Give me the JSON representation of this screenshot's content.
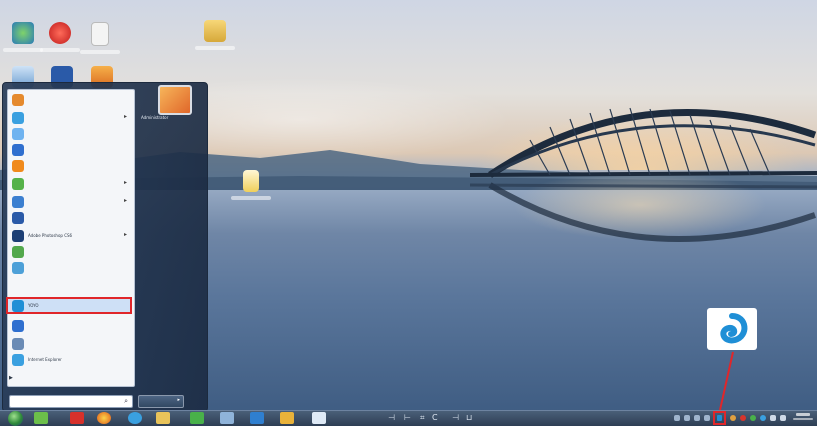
{
  "start_menu": {
    "programs": [
      {
        "label": "",
        "has_arrow": false,
        "icon": "package-icon",
        "color": "#e58a2e"
      },
      {
        "label": "",
        "has_arrow": true,
        "icon": "browser-icon",
        "color": "#3aa0e0"
      },
      {
        "label": "",
        "has_arrow": false,
        "icon": "document-icon",
        "color": "#6fb3f0"
      },
      {
        "label": "",
        "has_arrow": false,
        "icon": "bird-icon",
        "color": "#2f6fcf"
      },
      {
        "label": "",
        "has_arrow": false,
        "icon": "app-icon",
        "color": "#f08a1c"
      },
      {
        "label": "",
        "has_arrow": true,
        "icon": "sogou-icon",
        "color": "#55b24a"
      },
      {
        "label": "",
        "has_arrow": true,
        "icon": "window-icon",
        "color": "#3b7fd0"
      },
      {
        "label": "",
        "has_arrow": false,
        "icon": "k-icon",
        "color": "#2a5aa8"
      },
      {
        "label": "Adobe Photoshop CS6",
        "has_arrow": true,
        "icon": "photoshop-icon",
        "color": "#1c3f75"
      },
      {
        "label": "",
        "has_arrow": false,
        "icon": "green-app-icon",
        "color": "#52a84c"
      },
      {
        "label": "",
        "has_arrow": false,
        "icon": "globe-icon",
        "color": "#4da0d8"
      },
      {
        "label": "YOYO",
        "has_arrow": false,
        "icon": "swirl-icon",
        "color": "#1f8fd6"
      },
      {
        "label": "",
        "has_arrow": false,
        "icon": "blue-app-icon",
        "color": "#2f6fcf"
      },
      {
        "label": "",
        "has_arrow": false,
        "icon": "tools-icon",
        "color": "#6a8bb5"
      },
      {
        "label": "Internet Explorer",
        "has_arrow": false,
        "icon": "ie-icon",
        "color": "#3aa0e0"
      }
    ],
    "all_programs": "▶",
    "search_glyph": "⌕",
    "right_links": [
      "Administrator",
      "",
      "",
      "",
      "",
      "",
      "",
      "",
      "",
      "",
      ""
    ],
    "shutdown_arrow": "▸"
  },
  "taskbar": {
    "middle_glyphs": [
      "⊣",
      "⊢",
      "⌗",
      "C",
      "⊣",
      "⊔"
    ]
  },
  "colors": {
    "highlight_border": "#e0262a",
    "app_swirl": "#1f8fd6"
  }
}
